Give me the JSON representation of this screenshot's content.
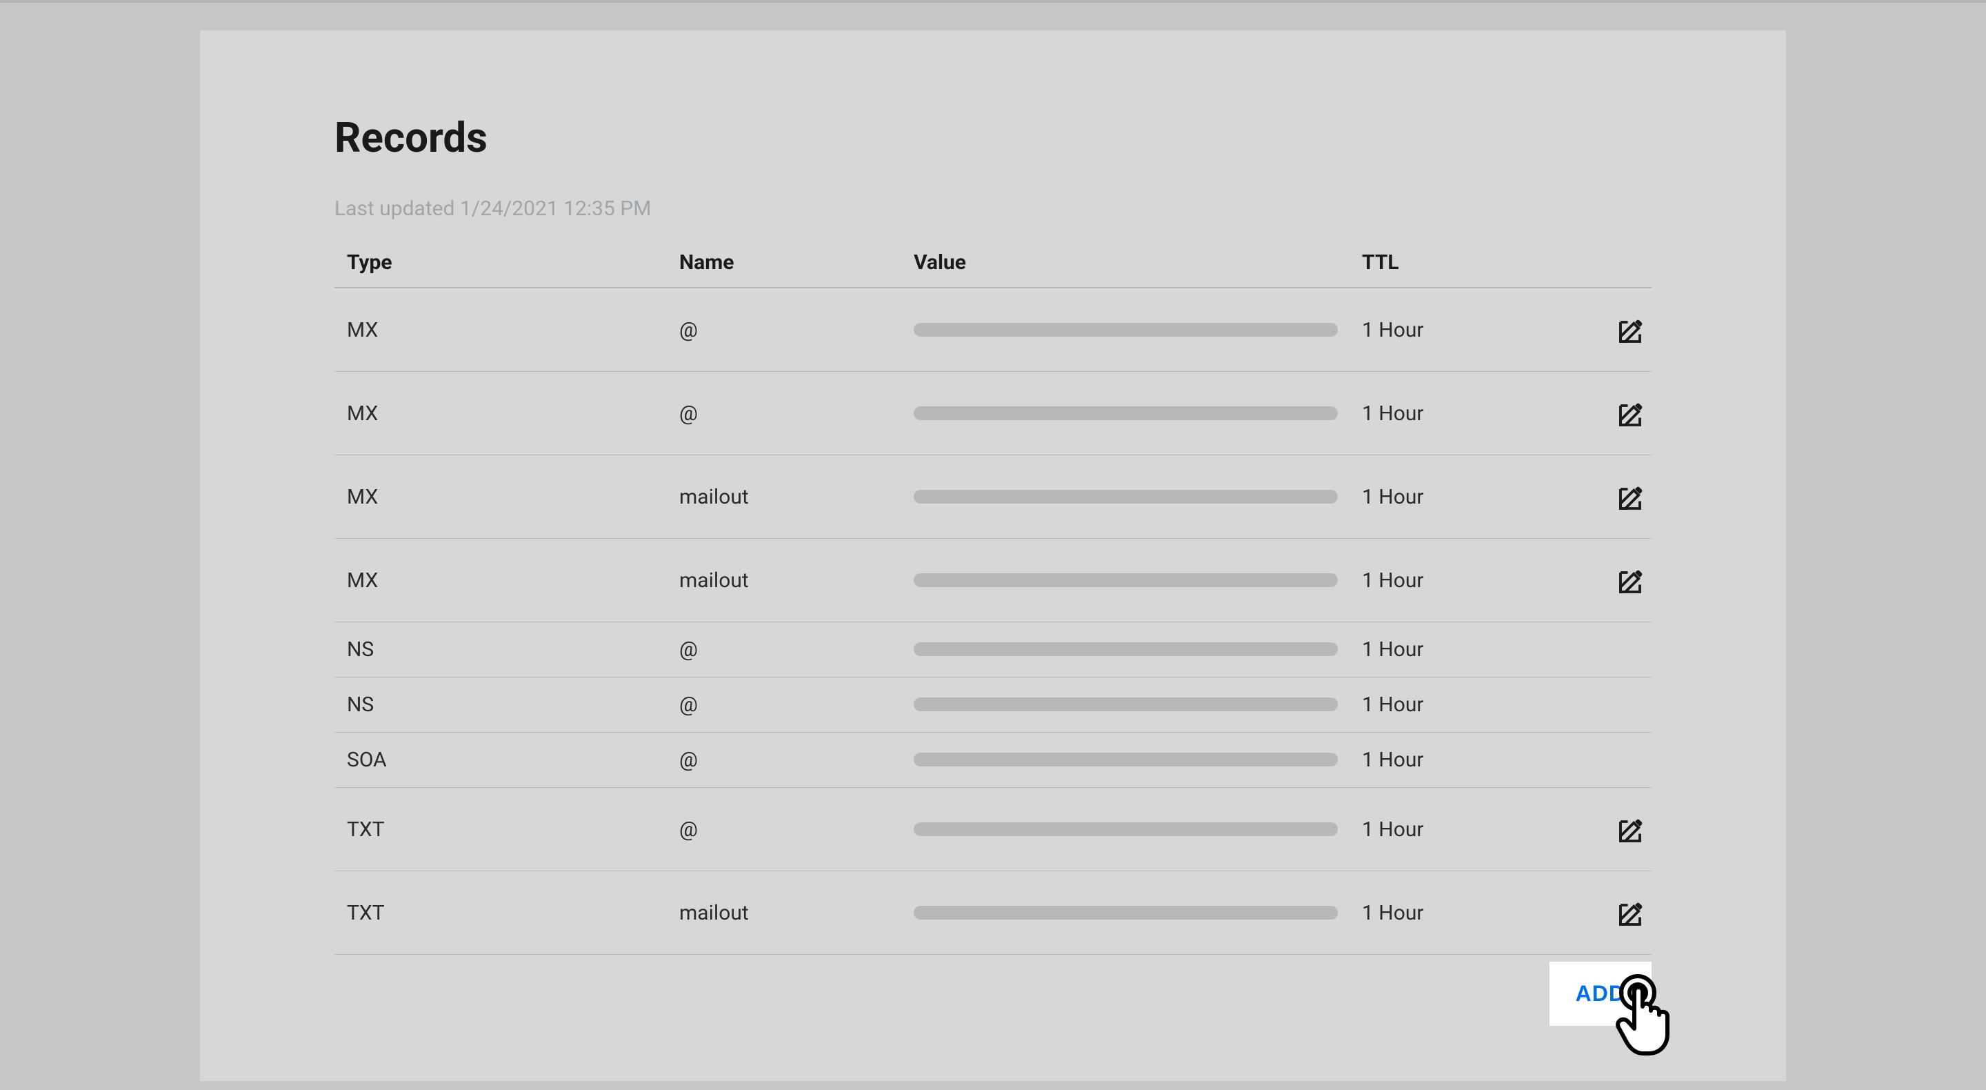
{
  "page": {
    "title": "Records",
    "lastUpdated": "Last updated 1/24/2021 12:35 PM",
    "addButton": "ADD"
  },
  "table": {
    "headers": {
      "type": "Type",
      "name": "Name",
      "value": "Value",
      "ttl": "TTL"
    },
    "rows": [
      {
        "type": "MX",
        "name": "@",
        "ttl": "1 Hour",
        "editable": true
      },
      {
        "type": "MX",
        "name": "@",
        "ttl": "1 Hour",
        "editable": true
      },
      {
        "type": "MX",
        "name": "mailout",
        "ttl": "1 Hour",
        "editable": true
      },
      {
        "type": "MX",
        "name": "mailout",
        "ttl": "1 Hour",
        "editable": true
      },
      {
        "type": "NS",
        "name": "@",
        "ttl": "1 Hour",
        "editable": false
      },
      {
        "type": "NS",
        "name": "@",
        "ttl": "1 Hour",
        "editable": false
      },
      {
        "type": "SOA",
        "name": "@",
        "ttl": "1 Hour",
        "editable": false
      },
      {
        "type": "TXT",
        "name": "@",
        "ttl": "1 Hour",
        "editable": true
      },
      {
        "type": "TXT",
        "name": "mailout",
        "ttl": "1 Hour",
        "editable": true
      }
    ]
  }
}
